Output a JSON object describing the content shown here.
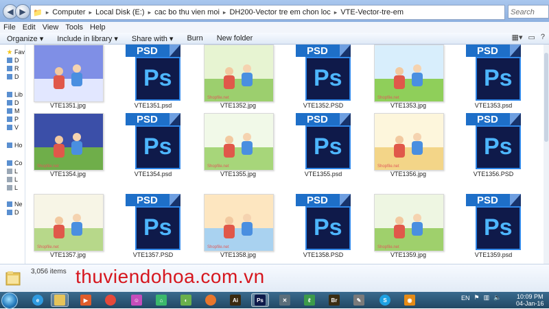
{
  "address": {
    "crumbs": [
      "Computer",
      "Local Disk (E:)",
      "cac bo thu vien moi",
      "DH200-Vector tre em chon loc",
      "VTE-Vector-tre-em"
    ],
    "search_placeholder": "Search VTE..."
  },
  "menu": [
    "File",
    "Edit",
    "View",
    "Tools",
    "Help"
  ],
  "toolbar": {
    "organize": "Organize ▾",
    "include_in_library": "Include in library ▾",
    "share_with": "Share with ▾",
    "burn": "Burn",
    "new_folder": "New folder"
  },
  "nav": [
    {
      "label": "Fav",
      "icon": "star-icon"
    },
    {
      "label": "D",
      "icon": "desktop-icon"
    },
    {
      "label": "R",
      "icon": "recent-icon"
    },
    {
      "label": "D",
      "icon": "downloads-icon"
    },
    {
      "label": "Lib",
      "icon": "libraries-icon"
    },
    {
      "label": "D",
      "icon": "documents-icon"
    },
    {
      "label": "M",
      "icon": "music-icon"
    },
    {
      "label": "P",
      "icon": "pictures-icon"
    },
    {
      "label": "V",
      "icon": "videos-icon"
    },
    {
      "label": "Ho",
      "icon": "homegroup-icon"
    },
    {
      "label": "Co",
      "icon": "computer-icon"
    },
    {
      "label": "L",
      "icon": "drive-icon"
    },
    {
      "label": "L",
      "icon": "drive-icon"
    },
    {
      "label": "L",
      "icon": "drive-icon"
    },
    {
      "label": "Ne",
      "icon": "network-icon"
    },
    {
      "label": "D",
      "icon": "network-pc-icon"
    }
  ],
  "files": [
    {
      "name": "VTE1351.jpg",
      "type": "jpg",
      "sky": "#7f8fe6",
      "ground": "#e2e7ff"
    },
    {
      "name": "VTE1351.psd",
      "type": "psd"
    },
    {
      "name": "VTE1352.jpg",
      "type": "jpg",
      "sky": "#e7f4d2",
      "ground": "#9ccf6e"
    },
    {
      "name": "VTE1352.PSD",
      "type": "psd"
    },
    {
      "name": "VTE1353.jpg",
      "type": "jpg",
      "sky": "#d8eefc",
      "ground": "#8fcf5a"
    },
    {
      "name": "VTE1353.psd",
      "type": "psd"
    },
    {
      "name": "VTE1354.jpg",
      "type": "jpg",
      "sky": "#3b4fa8",
      "ground": "#6fae4a"
    },
    {
      "name": "VTE1354.psd",
      "type": "psd"
    },
    {
      "name": "VTE1355.jpg",
      "type": "jpg",
      "sky": "#f1f9e8",
      "ground": "#a7d67a"
    },
    {
      "name": "VTE1355.psd",
      "type": "psd"
    },
    {
      "name": "VTE1356.jpg",
      "type": "jpg",
      "sky": "#fdf6dc",
      "ground": "#f3d588"
    },
    {
      "name": "VTE1356.PSD",
      "type": "psd"
    },
    {
      "name": "VTE1357.jpg",
      "type": "jpg",
      "sky": "#f7f5e6",
      "ground": "#b7d88a"
    },
    {
      "name": "VTE1357.PSD",
      "type": "psd"
    },
    {
      "name": "VTE1358.jpg",
      "type": "jpg",
      "sky": "#fde6c0",
      "ground": "#a9d2f0"
    },
    {
      "name": "VTE1358.PSD",
      "type": "psd"
    },
    {
      "name": "VTE1359.jpg",
      "type": "jpg",
      "sky": "#eef6e2",
      "ground": "#9fd06c"
    },
    {
      "name": "VTE1359.psd",
      "type": "psd"
    }
  ],
  "watermark_jpg": "Shopfile.net",
  "psd_badge": "PSD",
  "psd_logo": "Ps",
  "status": {
    "count": "3,056 items",
    "site_watermark": "thuviendohoa.com.vn"
  },
  "taskbar": {
    "apps": [
      {
        "icon": "ie-icon",
        "glyph": "e",
        "color": "#2f9be0"
      },
      {
        "icon": "explorer-icon",
        "glyph": "",
        "color": "#e6c45a",
        "active": true
      },
      {
        "icon": "media-player-icon",
        "glyph": "▶",
        "color": "#e05c2a"
      },
      {
        "icon": "chrome-icon",
        "glyph": "",
        "color": "#e5493a"
      },
      {
        "icon": "messenger-icon",
        "glyph": "☺",
        "color": "#c54dbb"
      },
      {
        "icon": "vpn-icon",
        "glyph": "⌂",
        "color": "#3bb86c"
      },
      {
        "icon": "corel-icon",
        "glyph": "◐",
        "color": "#6ab04c"
      },
      {
        "icon": "firefox-icon",
        "glyph": "",
        "color": "#e8762c"
      },
      {
        "icon": "illustrator-icon",
        "glyph": "Ai",
        "color": "#3a2a10"
      },
      {
        "icon": "photoshop-icon",
        "glyph": "Ps",
        "color": "#0f1a4a",
        "active": true
      },
      {
        "icon": "tool-icon",
        "glyph": "✕",
        "color": "#5a6e7a"
      },
      {
        "icon": "green-app-icon",
        "glyph": "ℓ",
        "color": "#3c9a4a"
      },
      {
        "icon": "bridge-icon",
        "glyph": "Br",
        "color": "#3a2d12"
      },
      {
        "icon": "pen-icon",
        "glyph": "✎",
        "color": "#7a7a7a"
      },
      {
        "icon": "skype-icon",
        "glyph": "S",
        "color": "#1da1e2"
      },
      {
        "icon": "orange-app-icon",
        "glyph": "◉",
        "color": "#e58b16"
      }
    ],
    "lang": "EN",
    "time": "10:09 PM",
    "date": "04-Jan-16"
  }
}
